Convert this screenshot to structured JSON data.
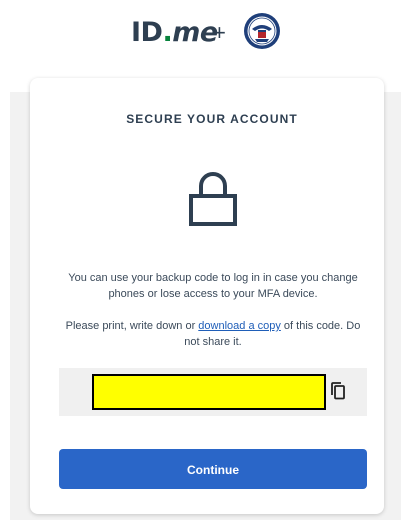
{
  "header": {
    "logo_id": "ID",
    "logo_dot": ".",
    "logo_me": "me",
    "plus": "+",
    "partner_icon": "ssa-seal-icon"
  },
  "card": {
    "title": "SECURE YOUR ACCOUNT",
    "icon": "lock-icon",
    "paragraph1": "You can use your backup code to log in in case you change phones or lose access to your MFA device.",
    "paragraph2_before": "Please print, write down or ",
    "paragraph2_link": "download a copy",
    "paragraph2_after": " of this code. Do not share it.",
    "backup_code": "",
    "copy_icon": "copy-icon",
    "continue_label": "Continue"
  },
  "colors": {
    "brand_text": "#2e3f51",
    "brand_green": "#08833d",
    "primary_button": "#2a66c8",
    "link": "#1f5eb8",
    "redaction": "#ffff00"
  }
}
